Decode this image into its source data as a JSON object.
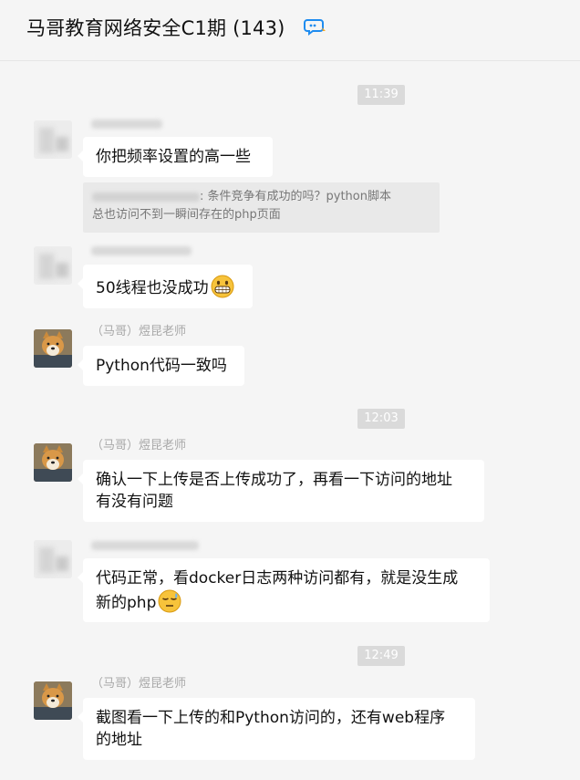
{
  "header": {
    "title": "马哥教育网络安全C1期 (143)",
    "icon": "chat-bubbles-icon",
    "accent_color": "#1e8cf0"
  },
  "timestamps": [
    "11:39",
    "12:03",
    "12:49"
  ],
  "messages": [
    {
      "sender": "",
      "text": "你把频率设置的高一些"
    },
    {
      "quote_prefix": ": 条件竞争有成功的吗？python脚本",
      "quote_line2": "总也访问不到一瞬间存在的php页面"
    },
    {
      "sender": "",
      "text": "50线程也没成功",
      "emoji": "grinning-face-icon"
    },
    {
      "sender": "（马哥）煜昆老师",
      "text": "Python代码一致吗"
    },
    {
      "sender": "（马哥）煜昆老师",
      "text_line1": "确认一下上传是否上传成功了，再看一下访问的地址",
      "text_line2": "有没有问题"
    },
    {
      "sender": "",
      "text_line1": "代码正常，看docker日志两种访问都有，就是没生成",
      "text_line2": "新的php",
      "emoji": "sleepy-face-icon"
    },
    {
      "sender": "（马哥）煜昆老师",
      "text_line1": "截图看一下上传的和Python访问的，还有web程序",
      "text_line2": "的地址"
    }
  ]
}
